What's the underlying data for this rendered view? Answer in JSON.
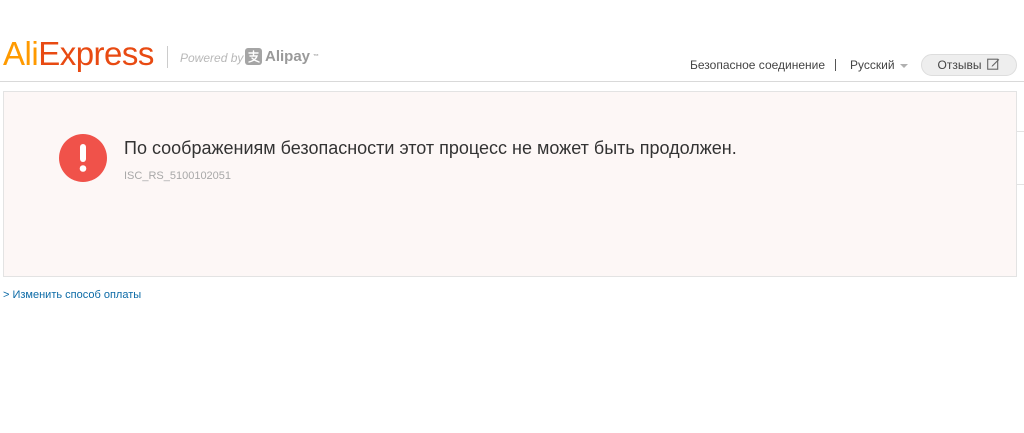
{
  "header": {
    "logo_ali": "Ali",
    "logo_express": "Express",
    "powered_by": "Powered by",
    "alipay": "Alipay",
    "alipay_tm": "™",
    "secure_connection": "Безопасное соединение",
    "language": "Русский",
    "feedback_label": "Отзывы"
  },
  "alert": {
    "title": "По соображениям безопасности этот процесс не может быть продолжен.",
    "code": "ISC_RS_5100102051",
    "icon_color": "#f0524a"
  },
  "footer": {
    "change_payment_link": "> Изменить способ оплаты"
  },
  "colors": {
    "brand_orange": "#ff9a00",
    "brand_red": "#e84a12",
    "link": "#0b6aa6",
    "panel_bg": "#fdf7f6"
  }
}
